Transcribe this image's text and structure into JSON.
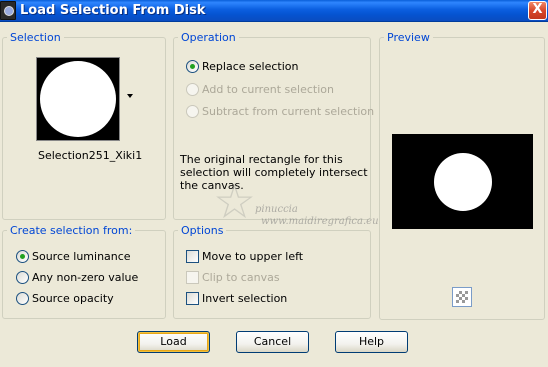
{
  "window": {
    "title": "Load Selection From Disk",
    "close_glyph": "X"
  },
  "selection": {
    "group_label": "Selection",
    "file_name": "Selection251_Xiki1"
  },
  "operation": {
    "group_label": "Operation",
    "options": [
      {
        "label": "Replace selection",
        "selected": true,
        "enabled": true
      },
      {
        "label": "Add to current selection",
        "selected": false,
        "enabled": false
      },
      {
        "label": "Subtract from current selection",
        "selected": false,
        "enabled": false
      }
    ],
    "info_text": "The original rectangle for this selection will completely intersect the canvas."
  },
  "preview": {
    "group_label": "Preview"
  },
  "create_from": {
    "group_label": "Create selection from:",
    "options": [
      {
        "label": "Source luminance",
        "selected": true
      },
      {
        "label": "Any non-zero value",
        "selected": false
      },
      {
        "label": "Source opacity",
        "selected": false
      }
    ]
  },
  "options": {
    "group_label": "Options",
    "items": [
      {
        "label": "Move to upper left",
        "checked": false,
        "enabled": true
      },
      {
        "label": "Clip to canvas",
        "checked": false,
        "enabled": false
      },
      {
        "label": "Invert selection",
        "checked": false,
        "enabled": true
      }
    ]
  },
  "buttons": {
    "load": "Load",
    "cancel": "Cancel",
    "help": "Help"
  },
  "watermark": {
    "line1": "pinuccia",
    "line2": "www.maidiregrafica.eu"
  },
  "colors": {
    "title_bar": "#0553d0",
    "group_label": "#0046d5",
    "dialog_bg": "#ece9d8",
    "radio_dot": "#21a121"
  }
}
